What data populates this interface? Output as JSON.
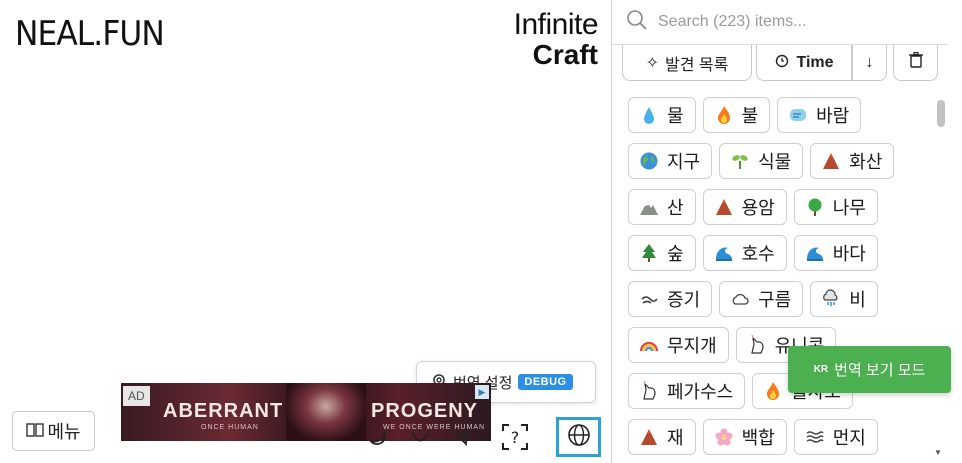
{
  "logo": {
    "text": "NEAL.FUN"
  },
  "brand": {
    "line1": "Infinite",
    "line2": "Craft"
  },
  "menu": {
    "label": "메뉴"
  },
  "ad": {
    "tag": "AD",
    "title1": "ABERRANT",
    "sub1": "ONCE HUMAN",
    "title2": "PROGENY",
    "sub2": "WE ONCE WERE HUMAN"
  },
  "translate": {
    "label": "번역 설정",
    "badge": "DEBUG"
  },
  "search": {
    "placeholder": "Search (223) items..."
  },
  "controls": {
    "discoveries": "발견 목록",
    "time": "Time",
    "sort_symbol": "↓"
  },
  "items": [
    {
      "icon": "water-drop-icon",
      "label": "물"
    },
    {
      "icon": "fire-icon",
      "label": "불"
    },
    {
      "icon": "wind-icon",
      "label": "바람"
    },
    {
      "icon": "earth-globe-icon",
      "label": "지구"
    },
    {
      "icon": "seedling-icon",
      "label": "식물"
    },
    {
      "icon": "volcano-icon",
      "label": "화산"
    },
    {
      "icon": "mountain-icon",
      "label": "산"
    },
    {
      "icon": "volcano-icon",
      "label": "용암"
    },
    {
      "icon": "tree-icon",
      "label": "나무"
    },
    {
      "icon": "evergreen-tree-icon",
      "label": "숲"
    },
    {
      "icon": "wave-icon",
      "label": "호수"
    },
    {
      "icon": "wave-icon",
      "label": "바다"
    },
    {
      "icon": "steam-icon",
      "label": "증기"
    },
    {
      "icon": "cloud-icon",
      "label": "구름"
    },
    {
      "icon": "rain-cloud-icon",
      "label": "비"
    },
    {
      "icon": "rainbow-icon",
      "label": "무지개"
    },
    {
      "icon": "unicorn-icon",
      "label": "유니콘"
    },
    {
      "icon": "unicorn-icon",
      "label": "페가수스"
    },
    {
      "icon": "fire-icon",
      "label": "불사조"
    },
    {
      "icon": "volcano-icon",
      "label": "재"
    },
    {
      "icon": "blossom-icon",
      "label": "백합"
    },
    {
      "icon": "waves-icon",
      "label": "먼지"
    }
  ],
  "toast": {
    "badge": "KR",
    "label": "번역 보기 모드"
  },
  "colors": {
    "accent_blue": "#2aa3d9",
    "debug_blue": "#2b8fe6",
    "toast_green": "#4caf50"
  }
}
